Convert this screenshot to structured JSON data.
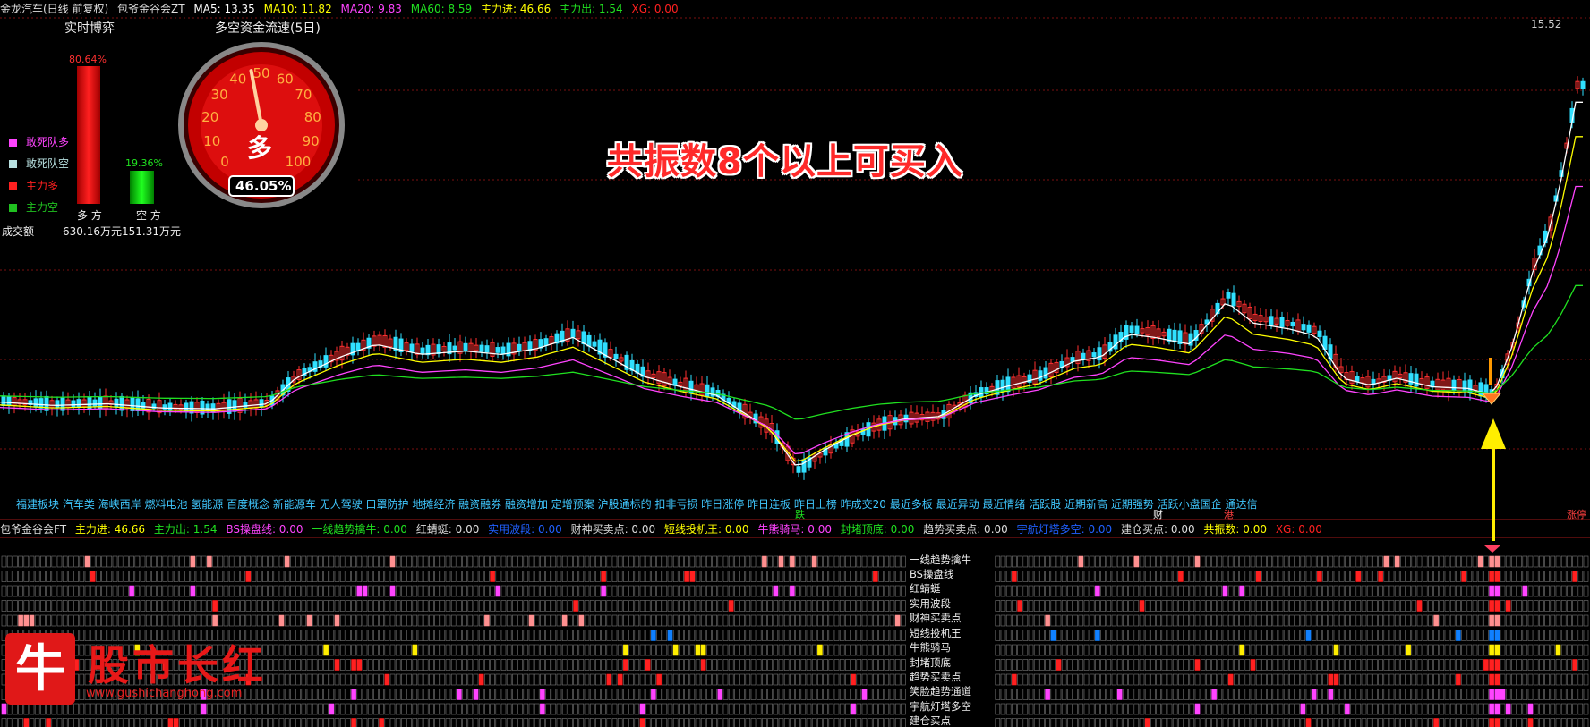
{
  "header": {
    "stock": "金龙汽车(日线 前复权)",
    "indicator": "包爷金谷会ZT",
    "ma5": "MA5: 13.35",
    "ma10": "MA10: 11.82",
    "ma20": "MA20: 9.83",
    "ma60": "MA60: 8.59",
    "main_in": "主力进: 46.66",
    "main_out": "主力出: 1.54",
    "xg": "XG: 0.00"
  },
  "left_panel": {
    "title": "实时博弈",
    "bull_pct": "80.64%",
    "bear_pct": "19.36%",
    "bull_fraction": 0.8064,
    "bear_fraction": 0.1936,
    "bull_label": "多 方",
    "bear_label": "空 方",
    "volume_label": "成交额",
    "bull_amount": "630.16万元",
    "bear_amount": "151.31万元",
    "legend": [
      {
        "label": "敢死队多",
        "color": "#ff44ff"
      },
      {
        "label": "敢死队空",
        "color": "#b8e0e0"
      },
      {
        "label": "主力多",
        "color": "#ff2020"
      },
      {
        "label": "主力空",
        "color": "#20c020"
      }
    ]
  },
  "gauge": {
    "title": "多空资金流速(5日)",
    "ticks": [
      "0",
      "10",
      "20",
      "30",
      "40",
      "50",
      "60",
      "70",
      "80",
      "90",
      "100"
    ],
    "center_label": "多",
    "value_text": "46.05%",
    "value": 46.05
  },
  "price_chart": {
    "high_label": "15.52"
  },
  "annotations": {
    "banner": "共振数8个以上可买入"
  },
  "concepts": "福建板块 汽车类 海峡西岸 燃料电池 氢能源 百度概念 新能源车 无人驾驶 口罩防护 地摊经济 融资融券 融资增加 定增预案 沪股通标的 扣非亏损 昨日涨停 昨日连板 昨日上榜 昨成交20 最近多板 最近异动 最近情绪 活跃股 近期新高 近期强势 活跃小盘国企 通达信",
  "axis_markers": {
    "die": "跌",
    "cai": "财",
    "gang": "港",
    "right": "涨停"
  },
  "bottom_header": {
    "indicator": "包爷金谷会FT",
    "items": [
      {
        "text": "主力进: 46.66",
        "color": "#ffff00"
      },
      {
        "text": "主力出: 1.54",
        "color": "#20e020"
      },
      {
        "text": "BS操盘线: 0.00",
        "color": "#ff44ff"
      },
      {
        "text": "一线趋势擒牛: 0.00",
        "color": "#20e020"
      },
      {
        "text": "红蜻蜓: 0.00",
        "color": "#dddddd"
      },
      {
        "text": "实用波段: 0.00",
        "color": "#2060ff"
      },
      {
        "text": "财神买卖点: 0.00",
        "color": "#dddddd"
      },
      {
        "text": "短线投机王: 0.00",
        "color": "#ffff00"
      },
      {
        "text": "牛熊骑马: 0.00",
        "color": "#ff44ff"
      },
      {
        "text": "封堵顶底: 0.00",
        "color": "#20e020"
      },
      {
        "text": "趋势买卖点: 0.00",
        "color": "#dddddd"
      },
      {
        "text": "宇航灯塔多空: 0.00",
        "color": "#2060ff"
      },
      {
        "text": "建仓买点: 0.00",
        "color": "#dddddd"
      },
      {
        "text": "共振数: 0.00",
        "color": "#ffff00"
      },
      {
        "text": "XG: 0.00",
        "color": "#ff2020"
      }
    ]
  },
  "signal_rows": [
    "一线趋势擒牛",
    "BS操盘线",
    "红蜻蜓",
    "实用波段",
    "财神买卖点",
    "短线投机王",
    "牛熊骑马",
    "封堵顶底",
    "趋势买卖点",
    "笑脸趋势通道",
    "宇航灯塔多空",
    "建仓买点"
  ],
  "watermark": {
    "logo_char": "牛",
    "title": "股市长红",
    "url": "www.gushichanghong.com"
  },
  "colors": {
    "up": "#ff3030",
    "down": "#30e0ff",
    "ma5": "#ffffff",
    "ma10": "#ffff00",
    "ma20": "#ff44ff",
    "ma60": "#20e020"
  }
}
